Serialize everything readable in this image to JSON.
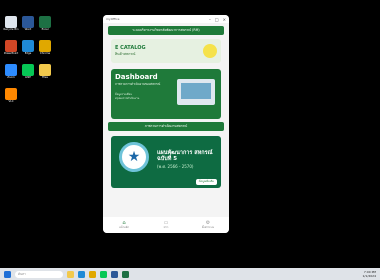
{
  "phone": {
    "app_name": "myOffice",
    "btn_top": "ระบบบริหารงานวิทยาลัยพัฒนาการสหกรณ์ (RM)",
    "catalog_title": "E CATALOG",
    "catalog_sub": "สินค้าสหกรณ์",
    "dashboard_title": "Dashboard",
    "dashboard_sub": "ภาพรวมการดำเนินงานของสหกรณ์",
    "dashboard_lines": [
      "ข้อมูลรายเดือน",
      "สรุปผลการดำเนินงาน"
    ],
    "btn_middle": "ภาพรวมการดำเนินงานสหกรณ์",
    "plan_title": "แผนพัฒนาการ สหกรณ์ฉบับที่ 5",
    "plan_years": "(พ.ศ. 2566 - 2570)",
    "plan_more": "ข้อมูลเพิ่มเติม",
    "nav": [
      "หน้าหลัก",
      "ข่าว",
      "ตั้งค่าระบบ"
    ]
  },
  "taskbar": {
    "search_placeholder": "ค้นหา",
    "time": "7:00 PM",
    "date": "1/1/2024"
  },
  "desktop_icons": [
    {
      "label": "Recycle Bin"
    },
    {
      "label": "Word"
    },
    {
      "label": "Excel"
    },
    {
      "label": "PowerPoint"
    },
    {
      "label": "Edge"
    },
    {
      "label": "Chrome"
    },
    {
      "label": "Zoom"
    },
    {
      "label": "LINE"
    },
    {
      "label": "Files"
    },
    {
      "label": "VLC"
    }
  ]
}
